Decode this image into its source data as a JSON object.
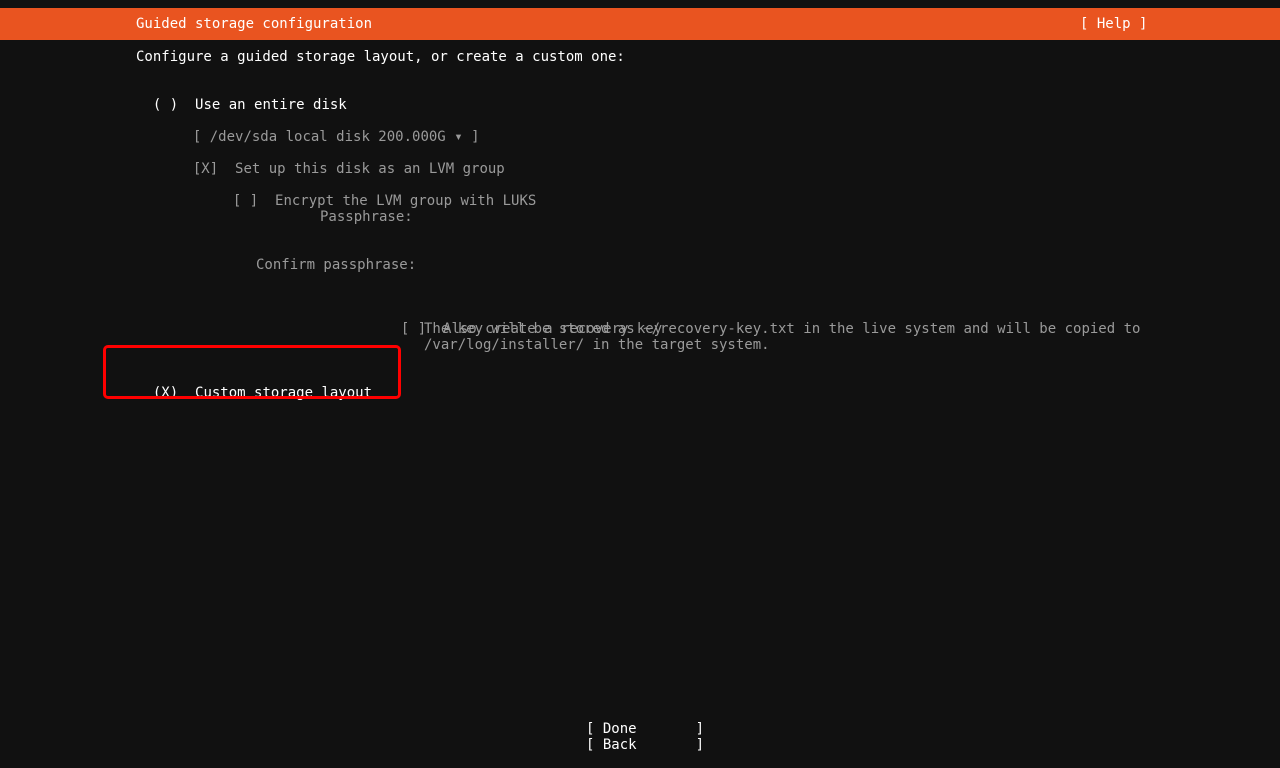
{
  "header": {
    "title": "Guided storage configuration",
    "help_label": "[ Help ]",
    "background_color": "#e95420"
  },
  "intro": "Configure a guided storage layout, or create a custom one:",
  "options": {
    "entire_disk": {
      "marker": "( )",
      "label": "Use an entire disk"
    },
    "disk_select": {
      "open_bracket": "[",
      "value": "/dev/sda local disk 200.000G",
      "arrow": "▾",
      "close_bracket": "]"
    },
    "lvm": {
      "marker": "[X]",
      "label": "Set up this disk as an LVM group"
    },
    "luks": {
      "marker": "[ ]",
      "label": "Encrypt the LVM group with LUKS"
    },
    "passphrase_label": "Passphrase:",
    "confirm_passphrase_label": "Confirm passphrase:",
    "recovery": {
      "marker": "[ ]",
      "label": "Also create a recovery key",
      "help_line1": "The key will be stored as ~/recovery-key.txt in the live system and will be copied to",
      "help_line2": "/var/log/installer/ in the target system."
    },
    "custom": {
      "marker": "(X)",
      "label": "Custom storage layout"
    }
  },
  "footer": {
    "done_label": "[ Done       ]",
    "back_label": "[ Back       ]"
  },
  "highlight_color": "#ff0000"
}
